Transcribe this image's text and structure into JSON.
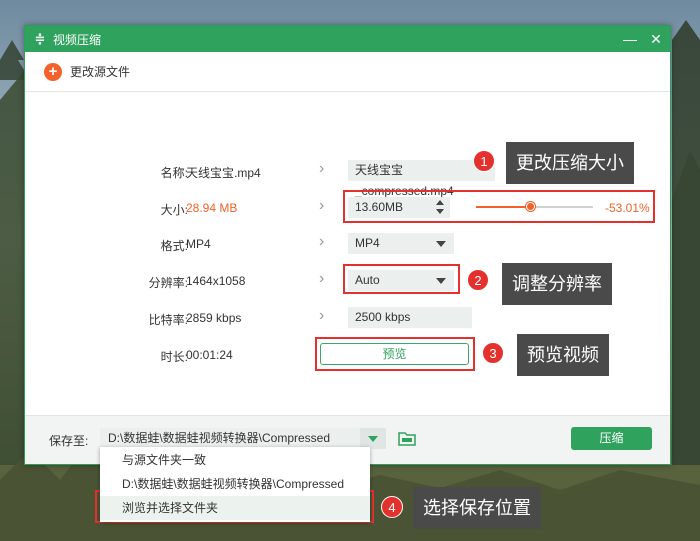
{
  "window": {
    "title": "视频压缩",
    "minimize_glyph": "—",
    "close_glyph": "✕"
  },
  "toolbar": {
    "change_source_label": "更改源文件"
  },
  "rows": {
    "name": {
      "label": "名称:",
      "source": "天线宝宝.mp4",
      "target": "天线宝宝_compressed.mp4"
    },
    "size": {
      "label": "大小:",
      "source": "28.94 MB",
      "target": "13.60MB",
      "percent": "-53.01%",
      "slider_fraction": 0.47
    },
    "format": {
      "label": "格式:",
      "source": "MP4",
      "target": "MP4"
    },
    "resolution": {
      "label": "分辨率:",
      "source": "1464x1058",
      "target": "Auto"
    },
    "bitrate": {
      "label": "比特率:",
      "source": "2859 kbps",
      "target": "2500 kbps"
    },
    "duration": {
      "label": "时长:",
      "source": "00:01:24",
      "preview_label": "预览"
    }
  },
  "footer": {
    "save_to_label": "保存至:",
    "path": "D:\\数据蛙\\数据蛙视频转换器\\Compressed",
    "compress_label": "压缩"
  },
  "dropdown_menu": {
    "items": [
      {
        "label": "与源文件夹一致"
      },
      {
        "label": "D:\\数据蛙\\数据蛙视频转换器\\Compressed"
      },
      {
        "label": "浏览并选择文件夹"
      }
    ]
  },
  "annotations": [
    {
      "number": "1",
      "text": "更改压缩大小"
    },
    {
      "number": "2",
      "text": "调整分辨率"
    },
    {
      "number": "3",
      "text": "预览视频"
    },
    {
      "number": "4",
      "text": "选择保存位置"
    }
  ],
  "colors": {
    "brand_green": "#2fa25d",
    "accent_orange": "#f2622a",
    "annotation_red": "#e5312e",
    "callout_gray": "#4a4a4a"
  },
  "icons": [
    "compress-icon",
    "plus-icon",
    "chevron-right-icon",
    "dropdown-arrow-icon",
    "folder-icon"
  ]
}
